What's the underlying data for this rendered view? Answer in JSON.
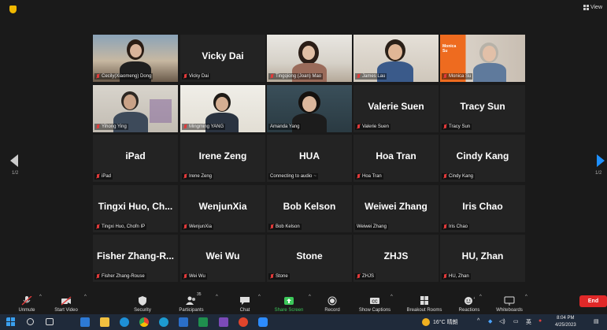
{
  "topbar": {
    "view_label": "View"
  },
  "pager": {
    "left": "1/2",
    "right": "1/2"
  },
  "participants": [
    {
      "id": "p1",
      "name": "Cecily(Xiaomeng) Dong",
      "big": "",
      "video": true
    },
    {
      "id": "p2",
      "name": "Vicky Dai",
      "big": "Vicky Dai",
      "video": false
    },
    {
      "id": "p3",
      "name": "Tingqiong (Joan) Mao",
      "big": "",
      "video": true
    },
    {
      "id": "p4",
      "name": "James Lau",
      "big": "",
      "video": true
    },
    {
      "id": "p5",
      "name": "Monica Su",
      "big": "",
      "video": true,
      "overlay": "Monica Su"
    },
    {
      "id": "p6",
      "name": "Yihong Ying",
      "big": "",
      "video": true
    },
    {
      "id": "p7",
      "name": "Mingming YANG",
      "big": "",
      "video": true
    },
    {
      "id": "p8",
      "name": "Amanda Yang",
      "big": "",
      "video": true
    },
    {
      "id": "p9",
      "name": "Valerie Suen",
      "big": "Valerie Suen",
      "video": false
    },
    {
      "id": "p10",
      "name": "Tracy Sun",
      "big": "Tracy Sun",
      "video": false
    },
    {
      "id": "p11",
      "name": "iPad",
      "big": "iPad",
      "video": false
    },
    {
      "id": "p12",
      "name": "Irene Zeng",
      "big": "Irene Zeng",
      "video": false
    },
    {
      "id": "p13",
      "name": "Connecting to audio",
      "big": "HUA",
      "video": false
    },
    {
      "id": "p14",
      "name": "Hoa Tran",
      "big": "Hoa Tran",
      "video": false
    },
    {
      "id": "p15",
      "name": "Cindy Kang",
      "big": "Cindy Kang",
      "video": false
    },
    {
      "id": "p16",
      "name": "Tingxi Huo, Chofn IP",
      "big": "Tingxi Huo, Ch...",
      "video": false
    },
    {
      "id": "p17",
      "name": "WenjunXia",
      "big": "WenjunXia",
      "video": false
    },
    {
      "id": "p18",
      "name": "Bob Kelson",
      "big": "Bob Kelson",
      "video": false
    },
    {
      "id": "p19",
      "name": "Weiwei Zhang",
      "big": "Weiwei Zhang",
      "video": false
    },
    {
      "id": "p20",
      "name": "Iris Chao",
      "big": "Iris Chao",
      "video": false
    },
    {
      "id": "p21",
      "name": "Fisher Zhang-Rouse",
      "big": "Fisher Zhang-R...",
      "video": false
    },
    {
      "id": "p22",
      "name": "Wei Wu",
      "big": "Wei Wu",
      "video": false
    },
    {
      "id": "p23",
      "name": "Stone",
      "big": "Stone",
      "video": false
    },
    {
      "id": "p24",
      "name": "ZHJS",
      "big": "ZHJS",
      "video": false
    },
    {
      "id": "p25",
      "name": "HU, Zhan",
      "big": "HU, Zhan",
      "video": false
    }
  ],
  "toolbar": {
    "unmute": "Unmute",
    "start_video": "Start Video",
    "security": "Security",
    "participants": "Participants",
    "participants_count": "35",
    "chat": "Chat",
    "share_screen": "Share Screen",
    "record": "Record",
    "show_captions": "Show Captions",
    "breakout_rooms": "Breakout Rooms",
    "reactions": "Reactions",
    "whiteboards": "Whiteboards",
    "end": "End"
  },
  "taskbar": {
    "weather": "16°C 晴朗",
    "ime": "英",
    "time": "8:04 PM",
    "date": "4/25/2023"
  },
  "colors": {
    "accent_green": "#3cc85a",
    "end_red": "#e02828",
    "active_border": "#e8e05a",
    "arrow_blue": "#1e90ff"
  }
}
